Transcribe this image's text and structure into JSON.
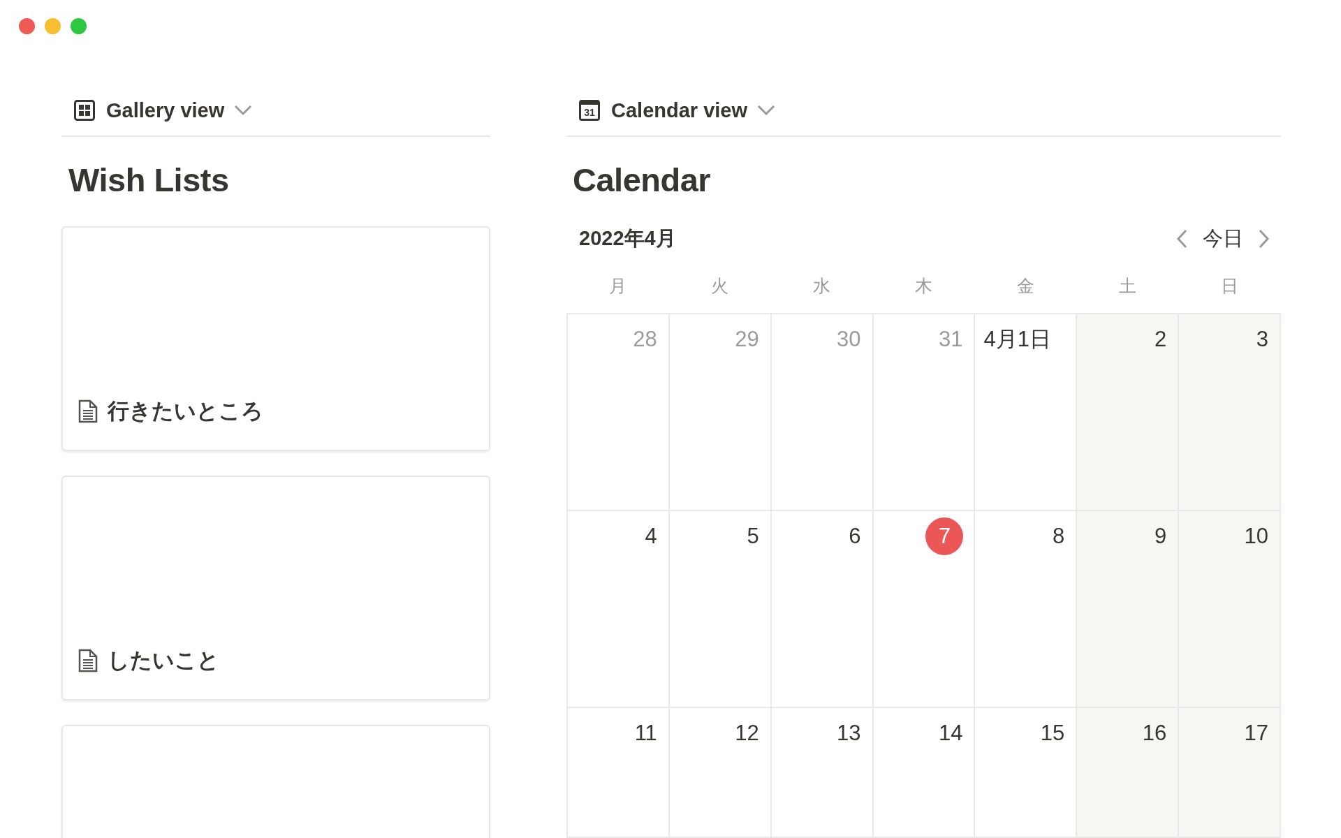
{
  "window_controls": [
    {
      "color": "#ee5b55"
    },
    {
      "color": "#f6be30"
    },
    {
      "color": "#2bc840"
    }
  ],
  "gallery": {
    "view": {
      "label": "Gallery view"
    },
    "title": "Wish Lists",
    "cards": [
      {
        "kind": "page",
        "title": "行きたいところ"
      },
      {
        "kind": "page",
        "title": "したいこと"
      },
      {
        "kind": "blank"
      }
    ]
  },
  "calendar": {
    "view": {
      "label": "Calendar view",
      "icon_label": "31"
    },
    "title": "Calendar",
    "month": "2022年4月",
    "today_button": "今日",
    "weekdays": [
      "月",
      "火",
      "水",
      "木",
      "金",
      "土",
      "日"
    ],
    "weeks": [
      [
        {
          "day": "28",
          "other_month": true,
          "weekend": false,
          "today": false
        },
        {
          "day": "29",
          "other_month": true,
          "weekend": false,
          "today": false
        },
        {
          "day": "30",
          "other_month": true,
          "weekend": false,
          "today": false
        },
        {
          "day": "31",
          "other_month": true,
          "weekend": false,
          "today": false
        },
        {
          "day": "4月1日",
          "other_month": false,
          "weekend": false,
          "today": false
        },
        {
          "day": "2",
          "other_month": false,
          "weekend": true,
          "today": false
        },
        {
          "day": "3",
          "other_month": false,
          "weekend": true,
          "today": false
        }
      ],
      [
        {
          "day": "4",
          "other_month": false,
          "weekend": false,
          "today": false
        },
        {
          "day": "5",
          "other_month": false,
          "weekend": false,
          "today": false
        },
        {
          "day": "6",
          "other_month": false,
          "weekend": false,
          "today": false
        },
        {
          "day": "7",
          "other_month": false,
          "weekend": false,
          "today": true
        },
        {
          "day": "8",
          "other_month": false,
          "weekend": false,
          "today": false
        },
        {
          "day": "9",
          "other_month": false,
          "weekend": true,
          "today": false
        },
        {
          "day": "10",
          "other_month": false,
          "weekend": true,
          "today": false
        }
      ],
      [
        {
          "day": "11",
          "other_month": false,
          "weekend": false,
          "today": false
        },
        {
          "day": "12",
          "other_month": false,
          "weekend": false,
          "today": false
        },
        {
          "day": "13",
          "other_month": false,
          "weekend": false,
          "today": false
        },
        {
          "day": "14",
          "other_month": false,
          "weekend": false,
          "today": false
        },
        {
          "day": "15",
          "other_month": false,
          "weekend": false,
          "today": false
        },
        {
          "day": "16",
          "other_month": false,
          "weekend": true,
          "today": false
        },
        {
          "day": "17",
          "other_month": false,
          "weekend": true,
          "today": false
        }
      ]
    ]
  }
}
